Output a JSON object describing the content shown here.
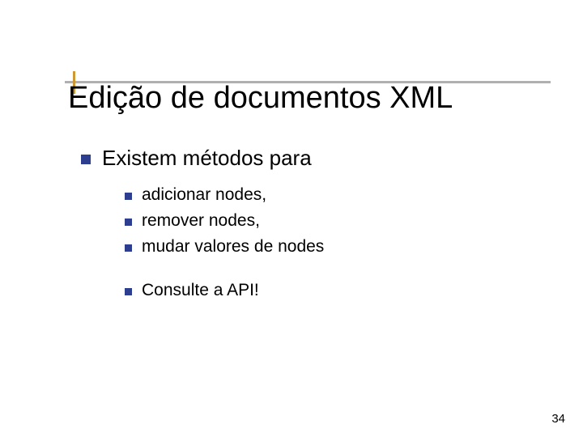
{
  "title": "Edição de documentos XML",
  "lvl1": "Existem métodos para",
  "sub": {
    "a": "adicionar nodes,",
    "b": "remover nodes,",
    "c": "mudar valores de nodes",
    "d": "Consulte a API!"
  },
  "page": "34"
}
